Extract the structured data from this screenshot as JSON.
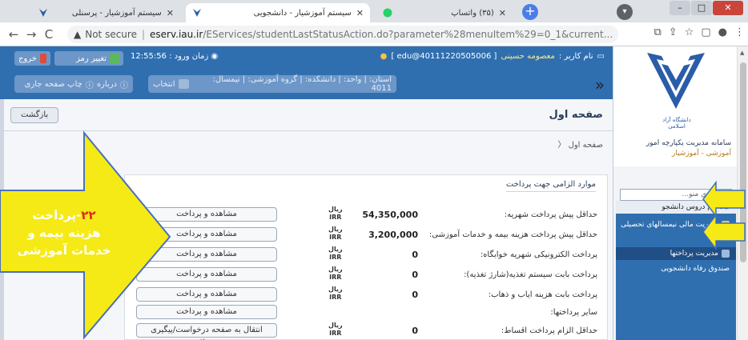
{
  "tabs": [
    {
      "label": "سیستم آموزشیار - پرسنلی",
      "active": false
    },
    {
      "label": "سیستم آموزشیار - دانشجویی",
      "active": true
    },
    {
      "label": "(۳۵) واتساپ",
      "active": false
    }
  ],
  "address": {
    "security": "Not secure",
    "host": "eserv.iau.ir",
    "path": "/EServices/studentLastStatusAction.do?parameter%28menuItem%29=0_1&current..."
  },
  "header": {
    "logout_label": "خروج",
    "change_password_label": "تغییر رمز",
    "login_time_label": "زمان ورود :",
    "login_time": "12:55:56",
    "user_id": "[ edu@40111220505006 ]",
    "user_name_label": "نام کاربر :",
    "user_name": "معصومه حسینی",
    "print_label": "چاپ صفحه جاری",
    "about_label": "درباره",
    "choose_label": "انتخاب",
    "term_info": "استان: | واحد: | دانشکده: | گروه آموزشی: | نیمسال: 4011"
  },
  "content": {
    "page_title": "صفحه اول",
    "back_label": "بازگشت",
    "breadcrumb": "صفحه اول  〈",
    "panel_title": "موارد الزامی جهت پرداخت",
    "currency_top": "ریال",
    "currency_bottom": "IRR",
    "rows": [
      {
        "label": "حداقل پیش پرداخت شهریه:",
        "amount": "54,350,000",
        "button": "مشاهده و پرداخت"
      },
      {
        "label": "حداقل پیش پرداخت هزینه بیمه و خدمات آموزشی:",
        "amount": "3,200,000",
        "button": "مشاهده و پرداخت"
      },
      {
        "label": "پرداخت الکترونیکی شهریه خوابگاه:",
        "amount": "0",
        "button": "مشاهده و پرداخت"
      },
      {
        "label": "پرداخت بابت سیستم تغذیه(شارژ تغذیه):",
        "amount": "0",
        "button": "مشاهده و پرداخت"
      },
      {
        "label": "پرداخت بابت هزینه ایاب و ذهاب:",
        "amount": "0",
        "button": "مشاهده و پرداخت"
      },
      {
        "label": "سایر پرداختها:",
        "amount": "",
        "button": "مشاهده و پرداخت"
      },
      {
        "label": "حداقل الزام پرداخت اقساط:",
        "amount": "0",
        "button": "انتقال به صفحه درخواست/پیگیری تسهیلات"
      }
    ]
  },
  "sidebar": {
    "system_title": "سامانه مدیریت یکپارچه امور",
    "system_subtitle": "آموزشی - آموزشیار",
    "logo_caption": "دانشگاه آزاد اسلامی",
    "search_placeholder": "جستجوی منو...",
    "menu": [
      {
        "label": "ثبت نام دروس دانشجو",
        "selected": true
      },
      {
        "label": "مدیریت مالی نیمسالهای تحصیلی دانشجو",
        "selected": false
      },
      {
        "label": "مدیریت پرداختها",
        "selected": false
      },
      {
        "label": "صندوق رفاه دانشجویی",
        "selected": false
      }
    ]
  },
  "callout": {
    "number": "۲۲",
    "line1": "-پرداخت",
    "line2": "هزینه بیمه و",
    "line3": "خدمات آموزشی"
  },
  "colors": {
    "brand_blue": "#2f6fb0",
    "callout_yellow": "#f6ea16",
    "callout_number": "#e02626"
  }
}
